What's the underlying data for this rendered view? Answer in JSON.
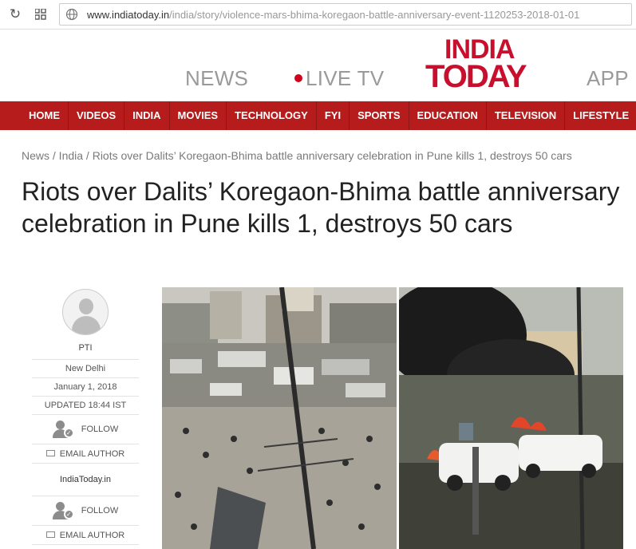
{
  "browser": {
    "url_host": "www.indiatoday.in",
    "url_path": "/india/story/violence-mars-bhima-koregaon-battle-anniversary-event-1120253-2018-01-01",
    "icons": [
      "reload-icon",
      "apps-icon",
      "globe-icon"
    ]
  },
  "header": {
    "news": "NEWS",
    "live_tv": "LIVE TV",
    "app": "APP",
    "logo_line1": "INDIA",
    "logo_line2": "TODAY",
    "live_dot_color": "#d0021b",
    "logo_color": "#c8102e"
  },
  "nav": {
    "color": "#b71c1c",
    "items": [
      "HOME",
      "VIDEOS",
      "INDIA",
      "MOVIES",
      "TECHNOLOGY",
      "FYI",
      "SPORTS",
      "EDUCATION",
      "TELEVISION",
      "LIFESTYLE"
    ]
  },
  "breadcrumb": "News / India / Riots over Dalits’ Koregaon-Bhima battle anniversary celebration in Pune kills 1, destroys 50 cars",
  "article": {
    "title": "Riots over Dalits’ Koregaon-Bhima battle anniversary celebration in Pune kills 1, destroys 50 cars"
  },
  "author": {
    "name": "PTI",
    "location": "New Delhi",
    "date": "January 1, 2018",
    "updated": "UPDATED 18:44 IST",
    "follow": "FOLLOW",
    "email": "EMAIL AUTHOR",
    "source": "IndiaToday.in",
    "follow2": "FOLLOW",
    "email2": "EMAIL AUTHOR"
  }
}
